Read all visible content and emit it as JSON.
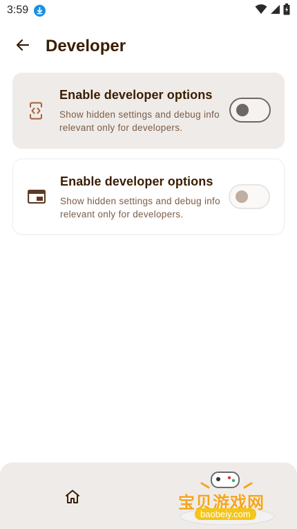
{
  "status_bar": {
    "time": "3:59",
    "icons": [
      "download-badge",
      "wifi-icon",
      "signal-icon",
      "battery-icon"
    ]
  },
  "header": {
    "title": "Developer",
    "back_icon": "arrow-left-icon"
  },
  "settings": [
    {
      "icon": "code-icon",
      "title": "Enable developer options",
      "description": "Show hidden settings and debug info relevant only for developers.",
      "toggle_state": "on"
    },
    {
      "icon": "web-window-icon",
      "title": "Enable developer options",
      "description": "Show hidden settings and debug info relevant only for developers.",
      "toggle_state": "off"
    }
  ],
  "bottom_nav": {
    "home_icon": "home-icon"
  },
  "watermark": {
    "text": "宝贝游戏网",
    "url": "baobeiy.com"
  },
  "colors": {
    "title": "#3a1d00",
    "description": "#7a5c46",
    "card_active_bg": "#efebe8",
    "accent_icon": "#a2623a"
  }
}
